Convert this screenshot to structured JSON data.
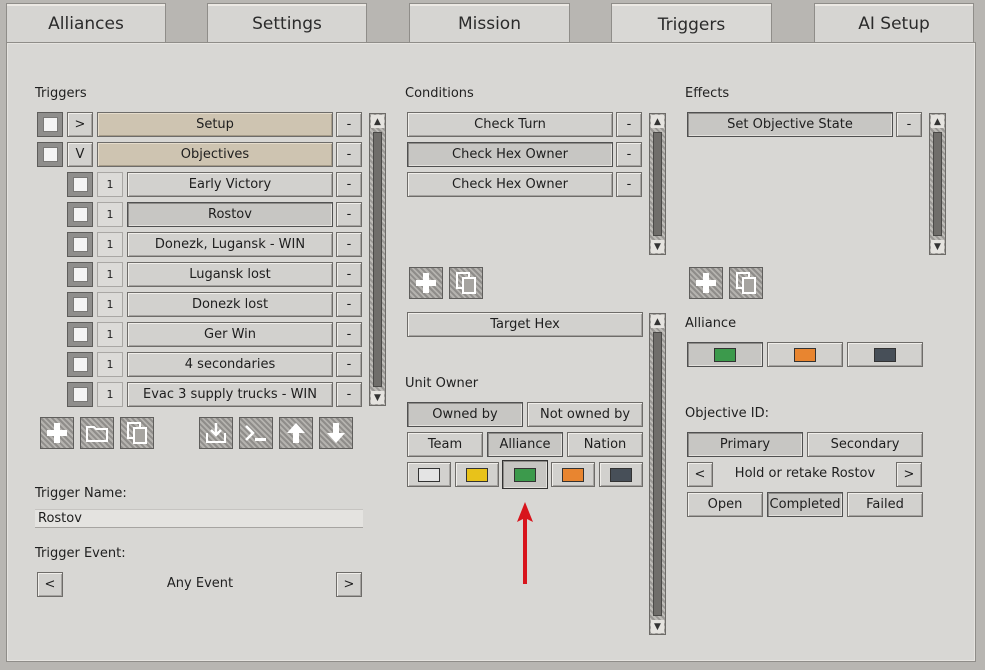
{
  "tabs": [
    {
      "label": "Alliances",
      "active": false
    },
    {
      "label": "Settings",
      "active": false
    },
    {
      "label": "Mission",
      "active": false
    },
    {
      "label": "Triggers",
      "active": true
    },
    {
      "label": "AI Setup",
      "active": false
    }
  ],
  "triggers": {
    "header": "Triggers",
    "groups": [
      {
        "expander": ">",
        "label": "Setup",
        "remove": "-"
      },
      {
        "expander": "V",
        "label": "Objectives",
        "remove": "-"
      }
    ],
    "items": [
      {
        "num": "1",
        "label": "Early Victory",
        "remove": "-"
      },
      {
        "num": "1",
        "label": "Rostov",
        "remove": "-",
        "selected": true
      },
      {
        "num": "1",
        "label": "Donezk, Lugansk - WIN",
        "remove": "-"
      },
      {
        "num": "1",
        "label": "Lugansk lost",
        "remove": "-"
      },
      {
        "num": "1",
        "label": "Donezk lost",
        "remove": "-"
      },
      {
        "num": "1",
        "label": "Ger Win",
        "remove": "-"
      },
      {
        "num": "1",
        "label": "4 secondaries",
        "remove": "-"
      },
      {
        "num": "1",
        "label": "Evac 3 supply trucks - WIN",
        "remove": "-"
      }
    ],
    "toolbar_icons": [
      "add-icon",
      "folder-icon",
      "copy-icon",
      "import-icon",
      "script-icon",
      "move-up-icon",
      "move-down-icon"
    ],
    "name_label": "Trigger Name:",
    "name_value": "Rostov",
    "event_label": "Trigger Event:",
    "event_prev": "<",
    "event_value": "Any Event",
    "event_next": ">"
  },
  "conditions": {
    "header": "Conditions",
    "items": [
      {
        "label": "Check Turn",
        "remove": "-"
      },
      {
        "label": "Check Hex Owner",
        "remove": "-",
        "selected": true
      },
      {
        "label": "Check Hex Owner",
        "remove": "-"
      }
    ],
    "target_hex": "Target Hex",
    "unit_owner_label": "Unit Owner",
    "owned_by": "Owned by",
    "not_owned_by": "Not owned by",
    "team": "Team",
    "alliance": "Alliance",
    "nation": "Nation",
    "colors": [
      "#e4e4e4",
      "#e8c21a",
      "#3c9a4c",
      "#e88530",
      "#474f58"
    ],
    "selected_color_index": 2
  },
  "effects": {
    "header": "Effects",
    "items": [
      {
        "label": "Set Objective State",
        "remove": "-"
      }
    ],
    "alliance_label": "Alliance",
    "alliance_colors": [
      "#3c9a4c",
      "#e88530",
      "#474f58"
    ],
    "objective_id_label": "Objective ID:",
    "primary": "Primary",
    "secondary": "Secondary",
    "obj_prev": "<",
    "obj_value": "Hold or retake Rostov",
    "obj_next": ">",
    "open": "Open",
    "completed": "Completed",
    "failed": "Failed"
  },
  "accent_arrow_color": "#d8141c"
}
